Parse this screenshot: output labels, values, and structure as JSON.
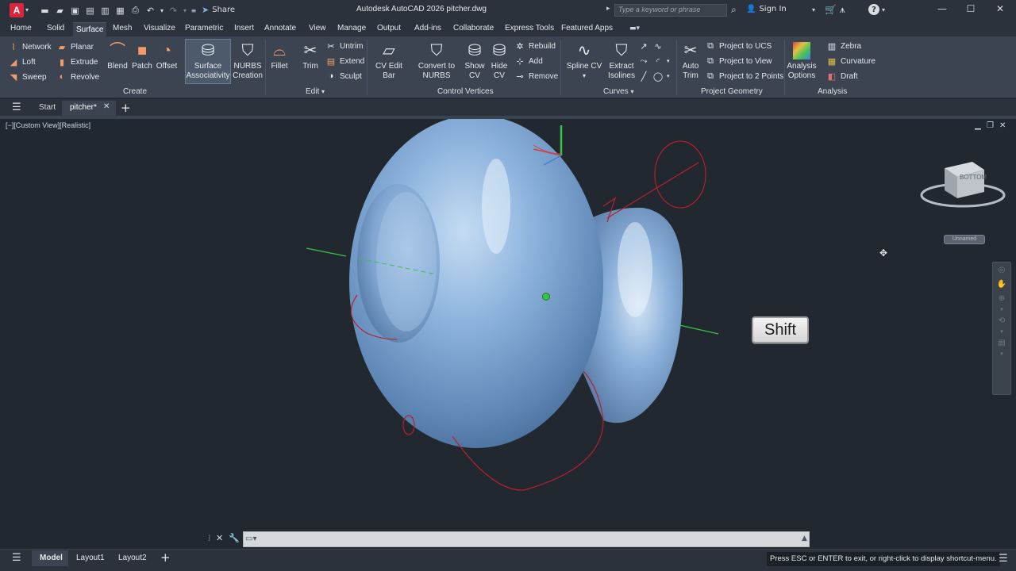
{
  "titlebar": {
    "app_logo": "A",
    "share_label": "Share",
    "window_title": "Autodesk AutoCAD 2026   pitcher.dwg",
    "search_placeholder": "Type a keyword or phrase",
    "signin_label": "Sign In"
  },
  "ribbon_tabs": [
    "Home",
    "Solid",
    "Surface",
    "Mesh",
    "Visualize",
    "Parametric",
    "Insert",
    "Annotate",
    "View",
    "Manage",
    "Output",
    "Add-ins",
    "Collaborate",
    "Express Tools",
    "Featured Apps"
  ],
  "active_ribbon_tab": "Surface",
  "ribbon": {
    "create": {
      "title": "Create",
      "network": "Network",
      "planar": "Planar",
      "loft": "Loft",
      "extrude": "Extrude",
      "sweep": "Sweep",
      "revolve": "Revolve",
      "blend": "Blend",
      "patch": "Patch",
      "offset": "Offset",
      "surface_assoc_1": "Surface",
      "surface_assoc_2": "Associativity",
      "nurbs_1": "NURBS",
      "nurbs_2": "Creation"
    },
    "edit": {
      "title": "Edit",
      "fillet": "Fillet",
      "trim": "Trim",
      "untrim": "Untrim",
      "extend": "Extend",
      "sculpt": "Sculpt"
    },
    "cv": {
      "title": "Control Vertices",
      "cv_edit_bar": "CV Edit Bar",
      "convert_1": "Convert to",
      "convert_2": "NURBS",
      "show_1": "Show",
      "show_2": "CV",
      "hide_1": "Hide",
      "hide_2": "CV",
      "rebuild": "Rebuild",
      "add": "Add",
      "remove": "Remove"
    },
    "curves": {
      "title": "Curves",
      "spline_cv": "Spline CV",
      "extract_1": "Extract",
      "extract_2": "Isolines"
    },
    "project": {
      "title": "Project Geometry",
      "auto_1": "Auto",
      "auto_2": "Trim",
      "to_ucs": "Project to UCS",
      "to_view": "Project to View",
      "to_2pts": "Project to 2 Points"
    },
    "analysis": {
      "title": "Analysis",
      "options_1": "Analysis",
      "options_2": "Options",
      "zebra": "Zebra",
      "curvature": "Curvature",
      "draft": "Draft"
    }
  },
  "file_tabs": {
    "start": "Start",
    "active": "pitcher*"
  },
  "viewport": {
    "view_label": "[−][Custom View][Realistic]",
    "viewcube_face": "BOTTOM",
    "viewcube_ucs": "Unnamed",
    "shift_key": "Shift"
  },
  "layout_tabs": [
    "Model",
    "Layout1",
    "Layout2"
  ],
  "status_message": "Press ESC or ENTER to exit, or right-click to display shortcut-menu.",
  "colors": {
    "surface_blue": "#7fa7d6",
    "accent_red": "#d7263d",
    "orbit_red": "#b8202a",
    "axis_green": "#39c24a"
  }
}
